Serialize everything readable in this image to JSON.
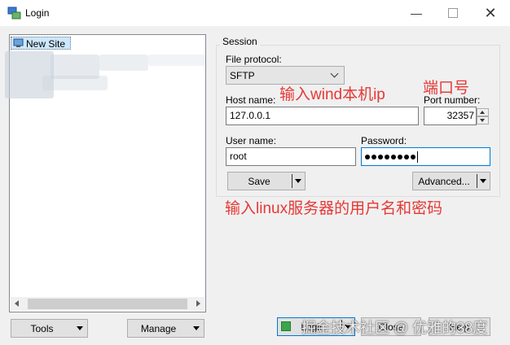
{
  "window": {
    "title": "Login"
  },
  "sidebar": {
    "new_site_label": "New Site",
    "tools_label": "Tools",
    "manage_label": "Manage"
  },
  "session": {
    "group_title": "Session",
    "file_protocol_label": "File protocol:",
    "file_protocol_value": "SFTP",
    "host_name_label": "Host name:",
    "host_name_value": "127.0.0.1",
    "port_number_label": "Port number:",
    "port_number_value": "32357",
    "user_name_label": "User name:",
    "user_name_value": "root",
    "password_label": "Password:",
    "password_masked_length": 8,
    "save_label": "Save",
    "advanced_label": "Advanced..."
  },
  "footer": {
    "login_label": "Login",
    "close_label": "Close",
    "help_label": "Help"
  },
  "annotations": {
    "host_note": "输入wind本机ip",
    "port_note": "端口号",
    "user_note": "输入linux服务器的用户名和密码"
  },
  "watermark": "掘金技术社区 @ 优雅的38度"
}
